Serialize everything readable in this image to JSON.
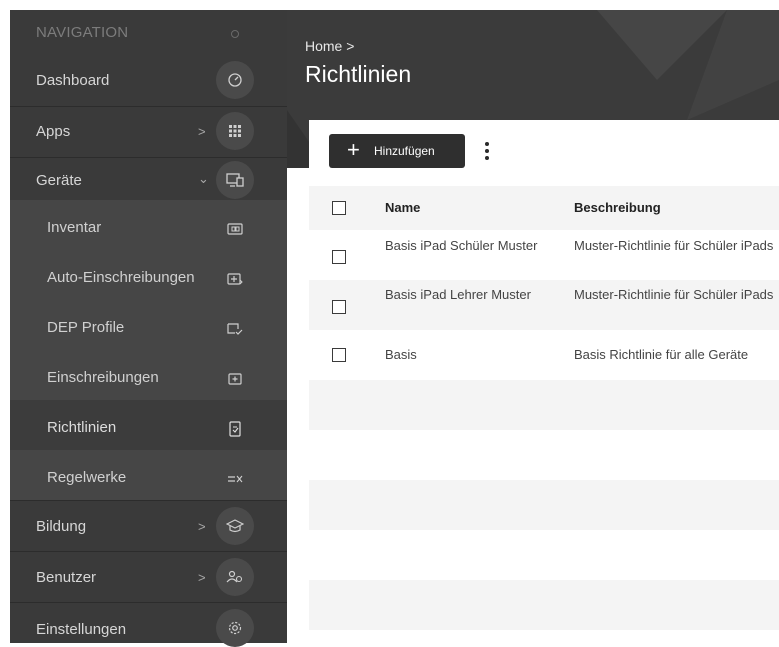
{
  "sidebar": {
    "header": "NAVIGATION",
    "items": [
      {
        "label": "Dashboard",
        "icon": "gauge-icon"
      },
      {
        "label": "Apps",
        "chevron": ">",
        "icon": "grid-icon"
      },
      {
        "label": "Geräte",
        "chevron": "⌄",
        "icon": "devices-icon"
      },
      {
        "label": "Bildung",
        "chevron": ">",
        "icon": "graduation-cap-icon"
      },
      {
        "label": "Benutzer",
        "chevron": ">",
        "icon": "users-icon"
      },
      {
        "label": "Einstellungen",
        "icon": "gear-icon"
      }
    ],
    "subitems": [
      {
        "label": "Inventar",
        "icon": "inventory-icon"
      },
      {
        "label": "Auto-Einschreibungen",
        "icon": "auto-enroll-icon"
      },
      {
        "label": "DEP Profile",
        "icon": "dep-profile-icon"
      },
      {
        "label": "Einschreibungen",
        "icon": "enrollment-icon"
      },
      {
        "label": "Richtlinien",
        "icon": "policy-icon"
      },
      {
        "label": "Regelwerke",
        "icon": "ruleset-icon"
      }
    ]
  },
  "header": {
    "breadcrumb": "Home >",
    "title": "Richtlinien"
  },
  "toolbar": {
    "add_symbol": "+",
    "add_label": "Hinzufügen"
  },
  "table": {
    "columns": [
      "Name",
      "Beschreibung"
    ],
    "rows": [
      {
        "name": "Basis iPad Schüler Muster",
        "description": "Muster-Richtlinie für Schüler iPads"
      },
      {
        "name": "Basis iPad Lehrer Muster",
        "description": "Muster-Richtlinie für Schüler iPads"
      },
      {
        "name": "Basis",
        "description": "Basis Richtlinie für alle Geräte"
      }
    ]
  },
  "colors": {
    "sidebar_bg": "#3a3a3a",
    "submenu_bg": "#464646",
    "header_bg": "#3b3b3b",
    "button_bg": "#2f2f2f",
    "row_alt_bg": "#f4f4f4"
  }
}
